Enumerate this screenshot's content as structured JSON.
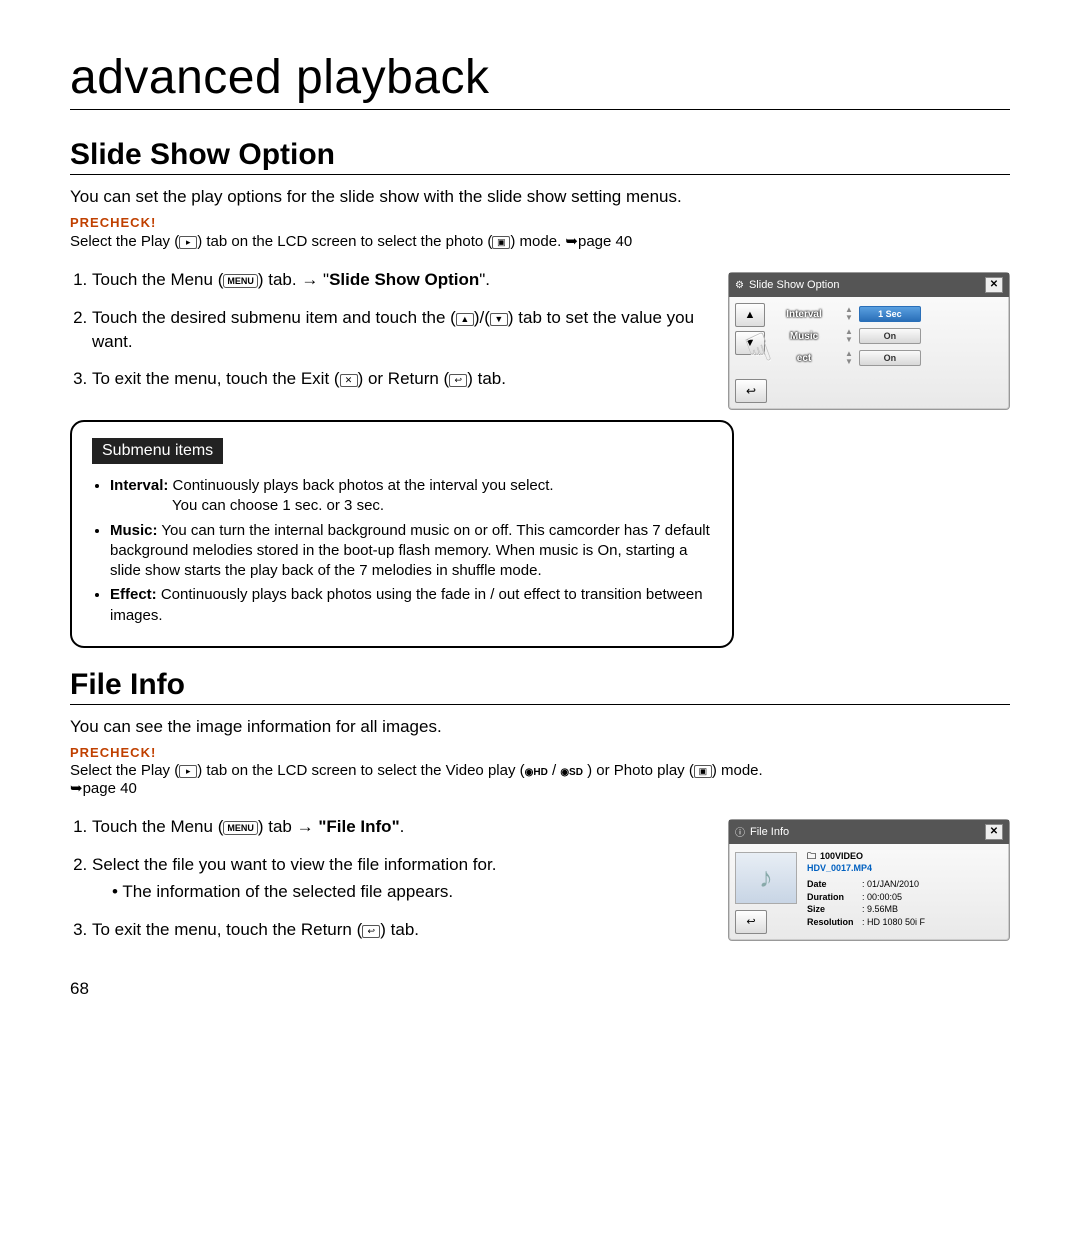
{
  "chapter_title": "advanced playback",
  "slide_show": {
    "title": "Slide Show Option",
    "intro": "You can set the play options for the slide show with the slide show setting menus.",
    "precheck_label": "PRECHECK!",
    "precheck_text_a": "Select the Play (",
    "precheck_text_b": ") tab on the LCD screen to select the photo (",
    "precheck_text_c": ") mode. ➥page 40",
    "step1_a": "Touch the Menu (",
    "step1_b": ") tab. ",
    "step1_arrow": "→",
    "step1_c": " \"",
    "step1_bold": "Slide Show Option",
    "step1_d": "\".",
    "step2_a": "Touch the desired submenu item and touch the (",
    "step2_b": ")/(",
    "step2_c": ") tab to set the value you want.",
    "step3_a": "To exit the menu, touch the Exit (",
    "step3_b": ") or Return (",
    "step3_c": ") tab.",
    "submenu_title": "Submenu items",
    "items": {
      "interval_name": "Interval:",
      "interval_text": " Continuously plays back photos at the interval you select.",
      "interval_cont": "You can choose 1 sec. or 3 sec.",
      "music_name": "Music:",
      "music_text": " You can turn the internal background music on or off. This camcorder has 7 default background melodies stored in the boot-up flash memory. When music is On, starting a slide show starts the play back of the 7 melodies in shuffle mode.",
      "effect_name": "Effect:",
      "effect_text": " Continuously plays back photos using the fade in / out effect to transition between images."
    },
    "lcd": {
      "title": "Slide Show Option",
      "row1_label": "Interval",
      "row1_val": "1 Sec",
      "row2_label": "Music",
      "row2_val": "On",
      "row3_label": "ect",
      "row3_val": "On"
    }
  },
  "file_info": {
    "title": "File Info",
    "intro": "You can see the image information for all images.",
    "precheck_label": "PRECHECK!",
    "precheck_a": "Select the Play (",
    "precheck_b": ") tab on the LCD screen to select the Video play (",
    "precheck_c": " / ",
    "precheck_d": " ) or Photo play (",
    "precheck_e": ") mode. ",
    "precheck_f": "➥page 40",
    "step1_a": "Touch the Menu (",
    "step1_b": ") tab ",
    "step1_arrow": "→",
    "step1_c": " ",
    "step1_bold": "\"File Info\"",
    "step1_d": ".",
    "step2": "Select the file you want to view the file information for.",
    "step2_bullet": "The information of the selected file appears.",
    "step3_a": "To exit the menu, touch the Return (",
    "step3_b": ") tab.",
    "lcd": {
      "title": "File Info",
      "folder": "100VIDEO",
      "filename": "HDV_0017.MP4",
      "date_k": "Date",
      "date_v": "01/JAN/2010",
      "duration_k": "Duration",
      "duration_v": "00:00:05",
      "size_k": "Size",
      "size_v": "9.56MB",
      "res_k": "Resolution",
      "res_v": "HD 1080 50i F"
    }
  },
  "icons": {
    "menu": "MENU",
    "play": "▸",
    "photo": "▣",
    "up": "▲",
    "down": "▼",
    "exit": "✕",
    "return": "↩",
    "hd": "◉HD",
    "sd": "◉SD",
    "folder": "🗀"
  },
  "page_number": "68"
}
